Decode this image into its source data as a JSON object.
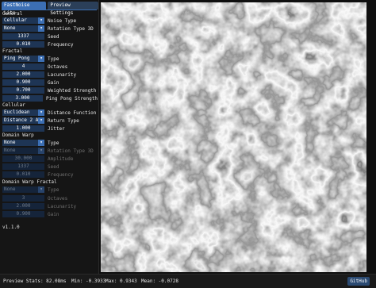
{
  "tabs": [
    {
      "label": "FastNoise Lite"
    },
    {
      "label": "Preview Settings"
    }
  ],
  "general": {
    "header": "General",
    "noise_type": {
      "value": "Cellular",
      "label": "Noise Type"
    },
    "rotation_type_3d": {
      "value": "None",
      "label": "Rotation Type 3D"
    },
    "seed": {
      "value": "1337",
      "label": "Seed"
    },
    "frequency": {
      "value": "0.010",
      "label": "Frequency"
    }
  },
  "fractal": {
    "header": "Fractal",
    "type": {
      "value": "Ping Pong",
      "label": "Type"
    },
    "octaves": {
      "value": "4",
      "label": "Octaves"
    },
    "lacunarity": {
      "value": "2.000",
      "label": "Lacunarity"
    },
    "gain": {
      "value": "0.900",
      "label": "Gain"
    },
    "weighted_strength": {
      "value": "0.700",
      "label": "Weighted Strength"
    },
    "ping_pong_strength": {
      "value": "3.000",
      "label": "Ping Pong Strength"
    }
  },
  "cellular": {
    "header": "Cellular",
    "distance_function": {
      "value": "Euclidean",
      "label": "Distance Function"
    },
    "return_type": {
      "value": "Distance 2 Add",
      "label": "Return Type"
    },
    "jitter": {
      "value": "1.000",
      "label": "Jitter"
    }
  },
  "domain_warp": {
    "header": "Domain Warp",
    "type": {
      "value": "None",
      "label": "Type"
    },
    "rotation_type_3d": {
      "value": "None",
      "label": "Rotation Type 3D"
    },
    "amplitude": {
      "value": "30.000",
      "label": "Amplitude"
    },
    "seed": {
      "value": "1337",
      "label": "Seed"
    },
    "frequency": {
      "value": "0.010",
      "label": "Frequency"
    }
  },
  "domain_warp_fractal": {
    "header": "Domain Warp Fractal",
    "type": {
      "value": "None",
      "label": "Type"
    },
    "octaves": {
      "value": "3",
      "label": "Octaves"
    },
    "lacunarity": {
      "value": "2.000",
      "label": "Lacunarity"
    },
    "gain": {
      "value": "0.900",
      "label": "Gain"
    }
  },
  "version": "v1.1.0",
  "status": {
    "preview_stats": "Preview Stats: 82.08ms",
    "min": "Min: -0.3933",
    "max": "Max: 0.9343",
    "mean": "Mean: -0.0728",
    "github_label": "GitHub"
  },
  "colors": {
    "accent": "#3c6fb4",
    "widget_bg": "#1e3555",
    "panel_bg": "#151515"
  }
}
